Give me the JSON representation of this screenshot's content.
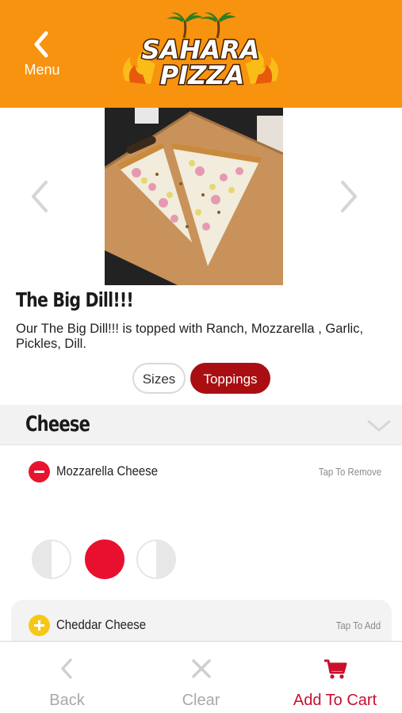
{
  "header": {
    "menu_label": "Menu",
    "logo_line1": "SAHARA",
    "logo_line2": "PIZZA"
  },
  "product": {
    "name": "The Big Dill!!!",
    "description": "Our The Big Dill!!! is topped with Ranch, Mozzarella , Garlic, Pickles, Dill."
  },
  "tabs": [
    {
      "label": "Sizes",
      "active": false
    },
    {
      "label": "Toppings",
      "active": true
    }
  ],
  "section": {
    "title": "Cheese"
  },
  "toppings": [
    {
      "name": "Mozzarella Cheese",
      "action": "Tap To Remove",
      "selected": true,
      "portion": "whole"
    },
    {
      "name": "Cheddar Cheese",
      "action": "Tap To Add",
      "selected": false
    }
  ],
  "toolbar": {
    "back_label": "Back",
    "clear_label": "Clear",
    "cart_label": "Add To Cart"
  },
  "colors": {
    "header_bg": "#f7930f",
    "accent_red": "#a90f12",
    "remove_red": "#e8142f",
    "add_yellow": "#f6c815",
    "cart_red": "#c8102e"
  }
}
